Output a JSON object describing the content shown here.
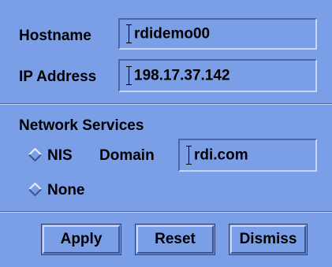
{
  "network": {
    "hostname_label": "Hostname",
    "hostname_value": "rdidemo00",
    "ip_label": "IP Address",
    "ip_value": "198.17.37.142"
  },
  "services": {
    "heading": "Network Services",
    "options": [
      {
        "label": "NIS",
        "selected": false
      },
      {
        "label": "None",
        "selected": false
      }
    ],
    "domain_label": "Domain",
    "domain_value": "rdi.com"
  },
  "buttons": {
    "apply": "Apply",
    "reset": "Reset",
    "dismiss": "Dismiss"
  },
  "colors": {
    "background": "#7b9fe6",
    "shadow": "#4a66a6",
    "highlight": "#c7d6fb"
  }
}
